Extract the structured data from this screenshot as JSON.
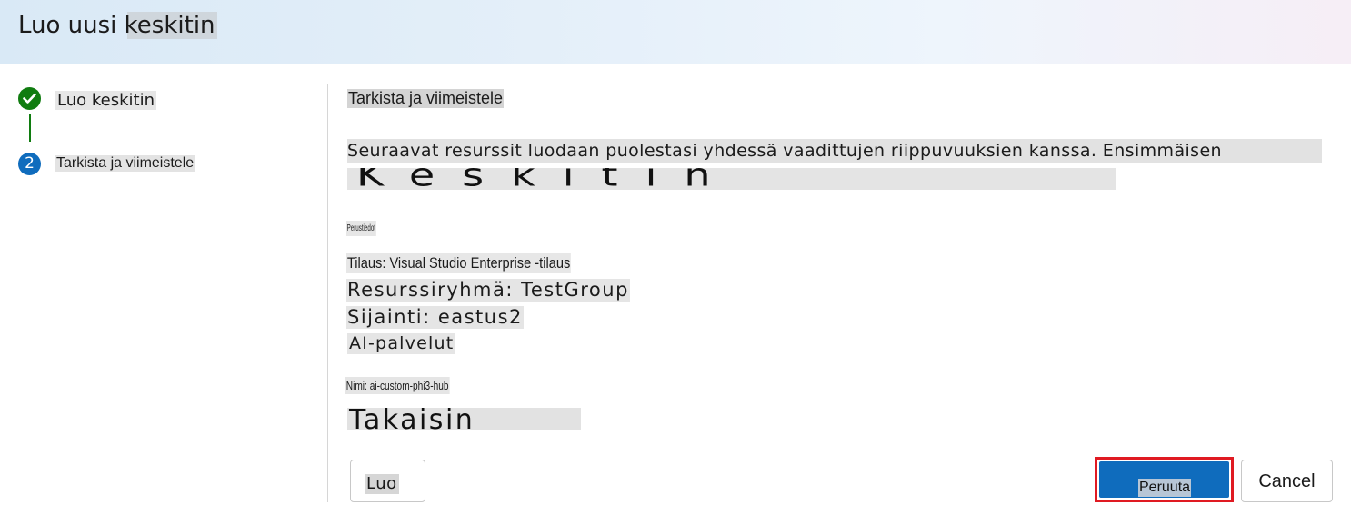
{
  "header": {
    "title": "Luo uusi keskitin"
  },
  "stepper": {
    "steps": [
      {
        "label": "Luo keskitin",
        "status": "completed",
        "icon": "checkmark-icon"
      },
      {
        "label": "Tarkista ja viimeistele",
        "status": "current",
        "number": "2"
      }
    ],
    "colors": {
      "completed": "#107c10",
      "current": "#0f6cbd"
    }
  },
  "main": {
    "heading": "Tarkista ja viimeistele",
    "intro": "Seuraavat resurssit luodaan puolestasi yhdessä vaadittujen riippuvuuksien kanssa. Ensimmäisen",
    "section_title": "Keskitin",
    "tiny_label": "Perustiedot",
    "subscription": "Tilaus: Visual Studio Enterprise -tilaus",
    "resource_group": "Resurssiryhmä: TestGroup",
    "location": "Sijainti: eastus2",
    "ai_services": "AI-palvelut",
    "name": "Nimi: ai-custom-phi3-hub",
    "back_label": "Takaisin"
  },
  "footer": {
    "create_label": "Luo",
    "primary_label": "Peruuta",
    "cancel_label": "Cancel",
    "primary_color": "#0f6cbd",
    "highlight_color": "#e01a22"
  }
}
